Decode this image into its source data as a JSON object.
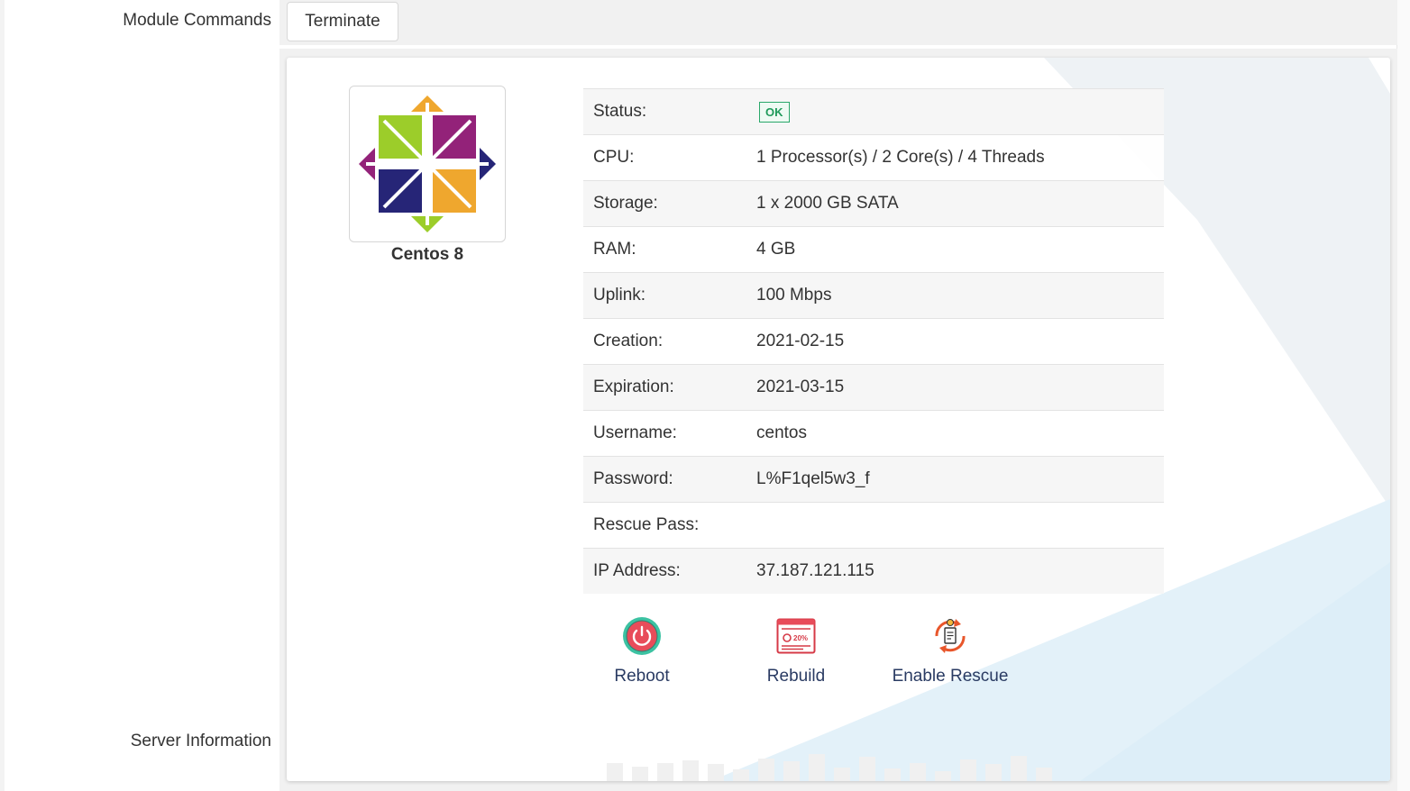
{
  "labels": {
    "module_commands": "Module Commands",
    "server_information": "Server Information"
  },
  "commands": {
    "terminate": "Terminate"
  },
  "os": {
    "name": "Centos 8",
    "logo_icon": "centos-logo-icon"
  },
  "status_badge": "OK",
  "details": [
    {
      "label": "Status:",
      "value": ""
    },
    {
      "label": "CPU:",
      "value": "1 Processor(s) / 2 Core(s) / 4 Threads"
    },
    {
      "label": "Storage:",
      "value": "1 x 2000 GB SATA"
    },
    {
      "label": "RAM:",
      "value": "4 GB"
    },
    {
      "label": "Uplink:",
      "value": "100 Mbps"
    },
    {
      "label": "Creation:",
      "value": "2021-02-15"
    },
    {
      "label": "Expiration:",
      "value": "2021-03-15"
    },
    {
      "label": "Username:",
      "value": "centos"
    },
    {
      "label": "Password:",
      "value": "L%F1qel5w3_f"
    },
    {
      "label": "Rescue Pass:",
      "value": ""
    },
    {
      "label": "IP Address:",
      "value": "37.187.121.115"
    }
  ],
  "actions": {
    "reboot": {
      "label": "Reboot",
      "icon": "power-icon"
    },
    "rebuild": {
      "label": "Rebuild",
      "icon": "rebuild-progress-icon"
    },
    "rescue": {
      "label": "Enable Rescue",
      "icon": "rescue-cycle-icon"
    }
  },
  "colors": {
    "status_ok": "#1f9a5a",
    "action_text": "#2a3b63",
    "accent_red": "#e84c5a",
    "accent_teal": "#3cc2a2"
  }
}
